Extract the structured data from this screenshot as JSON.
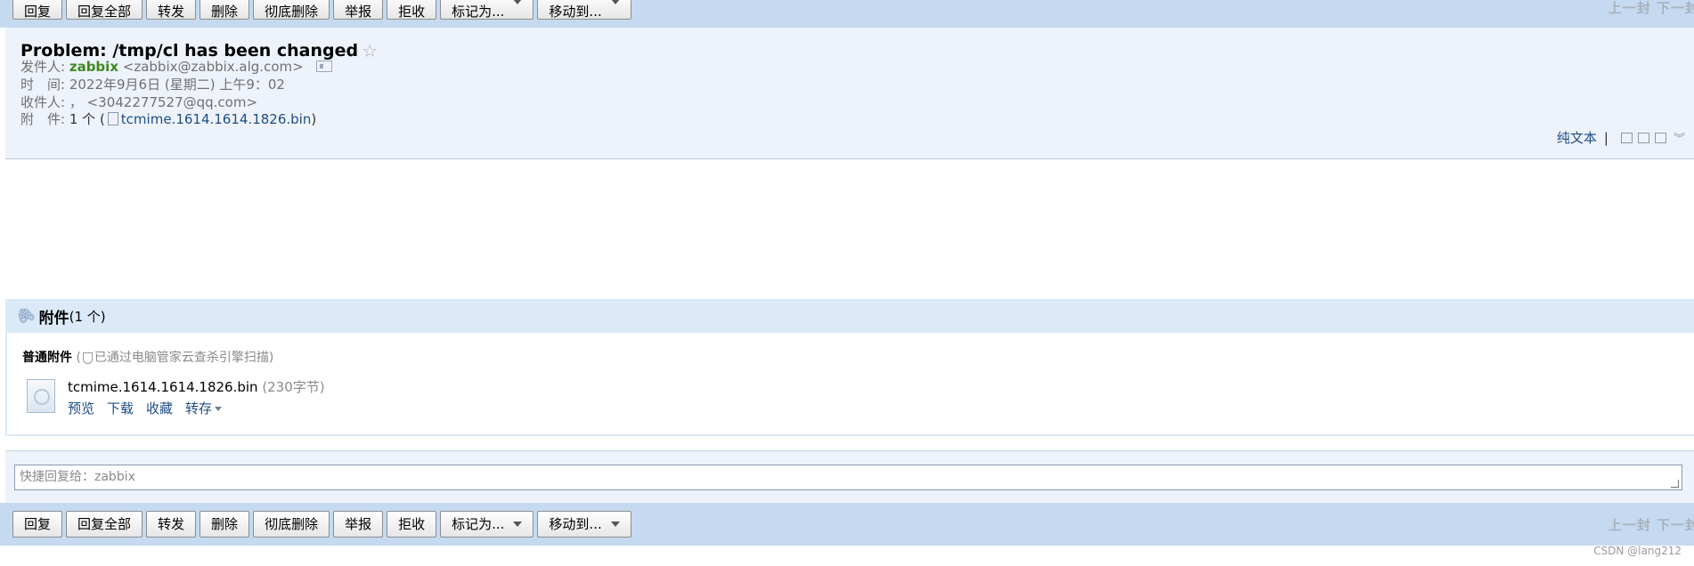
{
  "toolbar": {
    "buttons": [
      "回复",
      "回复全部",
      "转发",
      "删除",
      "彻底删除",
      "举报",
      "拒收",
      "标记为...",
      "移动到..."
    ],
    "pager": "上一封 下一封"
  },
  "mail": {
    "subject": "Problem: /tmp/cl has been changed",
    "from_label": "发件人:",
    "from_name": "zabbix",
    "from_email": "<zabbix@zabbix.alg.com>",
    "time_label": "时　间:",
    "time_value": "2022年9月6日 (星期二) 上午9：02",
    "to_label": "收件人:",
    "to_value": "，  <3042277527@qq.com>",
    "att_label": "附　件:",
    "att_count": "1 个",
    "att_file": "tcmime.1614.1614.1826.bin"
  },
  "header_tools": {
    "plain_text": "纯文本",
    "sep": "|"
  },
  "attachments": {
    "title": "附件",
    "count": "(1 个)",
    "section_label": "普通附件",
    "scan_note": "已通过电脑管家云查杀引擎扫描",
    "file_name": "tcmime.1614.1614.1826.bin",
    "file_size": "(230字节)",
    "actions": [
      "预览",
      "下载",
      "收藏",
      "转存"
    ]
  },
  "reply": {
    "placeholder": "快捷回复给：zabbix"
  },
  "watermark": "CSDN @lang212"
}
